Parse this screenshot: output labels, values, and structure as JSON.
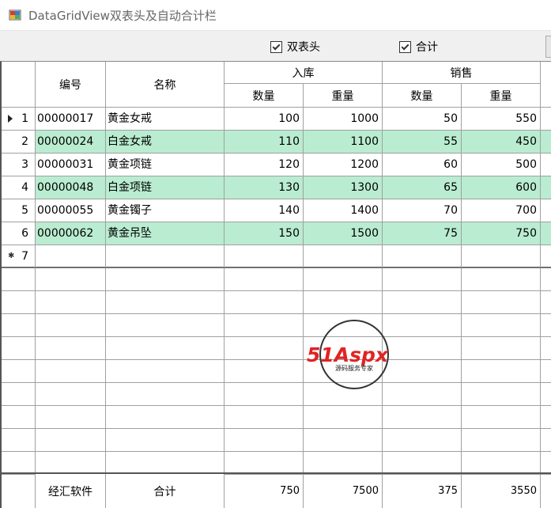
{
  "window": {
    "title": "DataGridView双表头及自动合计栏"
  },
  "toolbar": {
    "double_header_label": "双表头",
    "double_header_checked": true,
    "total_label": "合计",
    "total_checked": true
  },
  "colors": {
    "alt_row": "#b9ecd0",
    "border": "#a0a0a0"
  },
  "grid": {
    "headers": {
      "code": "编号",
      "name": "名称",
      "group_in": "入库",
      "group_sales": "销售",
      "qty": "数量",
      "weight": "重量"
    },
    "rows": [
      {
        "index": "1",
        "code": "00000017",
        "name": "黄金女戒",
        "in_qty": "100",
        "in_weight": "1000",
        "sale_qty": "50",
        "sale_weight": "550"
      },
      {
        "index": "2",
        "code": "00000024",
        "name": "白金女戒",
        "in_qty": "110",
        "in_weight": "1100",
        "sale_qty": "55",
        "sale_weight": "450"
      },
      {
        "index": "3",
        "code": "00000031",
        "name": "黄金项链",
        "in_qty": "120",
        "in_weight": "1200",
        "sale_qty": "60",
        "sale_weight": "500"
      },
      {
        "index": "4",
        "code": "00000048",
        "name": "白金项链",
        "in_qty": "130",
        "in_weight": "1300",
        "sale_qty": "65",
        "sale_weight": "600"
      },
      {
        "index": "5",
        "code": "00000055",
        "name": "黄金镯子",
        "in_qty": "140",
        "in_weight": "1400",
        "sale_qty": "70",
        "sale_weight": "700"
      },
      {
        "index": "6",
        "code": "00000062",
        "name": "黄金吊坠",
        "in_qty": "150",
        "in_weight": "1500",
        "sale_qty": "75",
        "sale_weight": "750"
      }
    ],
    "new_row_index": "7",
    "footer": {
      "company": "经汇软件",
      "label": "合计",
      "in_qty": "750",
      "in_weight": "7500",
      "sale_qty": "375",
      "sale_weight": "3550"
    }
  },
  "watermark": {
    "brand_main": "51Aspx",
    "brand_sub": "源码服务专家"
  }
}
